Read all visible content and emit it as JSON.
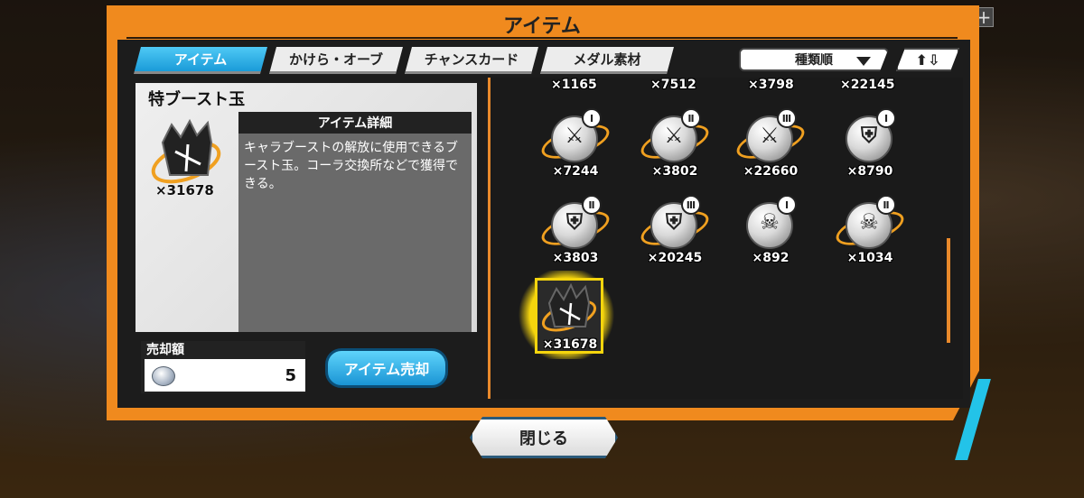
{
  "window": {
    "title": "アイテム"
  },
  "tabs": [
    {
      "label": "アイテム",
      "active": true
    },
    {
      "label": "かけら・オーブ",
      "active": false
    },
    {
      "label": "チャンスカード",
      "active": false
    },
    {
      "label": "メダル素材",
      "active": false
    }
  ],
  "sort": {
    "selected": "種類順",
    "order_icon": "up-down-arrows"
  },
  "detail": {
    "name": "特ブースト玉",
    "header": "アイテム詳細",
    "description": "キャラブーストの解放に使用できるブースト玉。コーラ交換所などで獲得できる。",
    "count": "×31678",
    "sell_label": "売却額",
    "sell_price": "5",
    "sell_button": "アイテム売却"
  },
  "grid": {
    "top_row_counts": [
      "×1165",
      "×7512",
      "×3798",
      "×22145"
    ],
    "rows": [
      [
        {
          "rank": "Ⅰ",
          "icon": "sword-icon",
          "count": "×7244"
        },
        {
          "rank": "Ⅱ",
          "icon": "sword-icon",
          "count": "×3802"
        },
        {
          "rank": "Ⅲ",
          "icon": "sword-icon",
          "count": "×22660"
        },
        {
          "rank": "Ⅰ",
          "icon": "armor-icon",
          "count": "×8790"
        }
      ],
      [
        {
          "rank": "Ⅱ",
          "icon": "armor-icon",
          "count": "×3803"
        },
        {
          "rank": "Ⅲ",
          "icon": "armor-icon",
          "count": "×20245"
        },
        {
          "rank": "Ⅰ",
          "icon": "skull-icon",
          "count": "×892"
        },
        {
          "rank": "Ⅱ",
          "icon": "skull-icon",
          "count": "×1034"
        }
      ],
      [
        {
          "rank": "",
          "icon": "boost-ball-icon",
          "count": "×31678",
          "selected": true
        }
      ]
    ]
  },
  "footer": {
    "close_label": "閉じる"
  },
  "colors": {
    "frame": "#f08a1e",
    "tab_active": "#1a9bd8",
    "selection": "#f5d50d"
  }
}
